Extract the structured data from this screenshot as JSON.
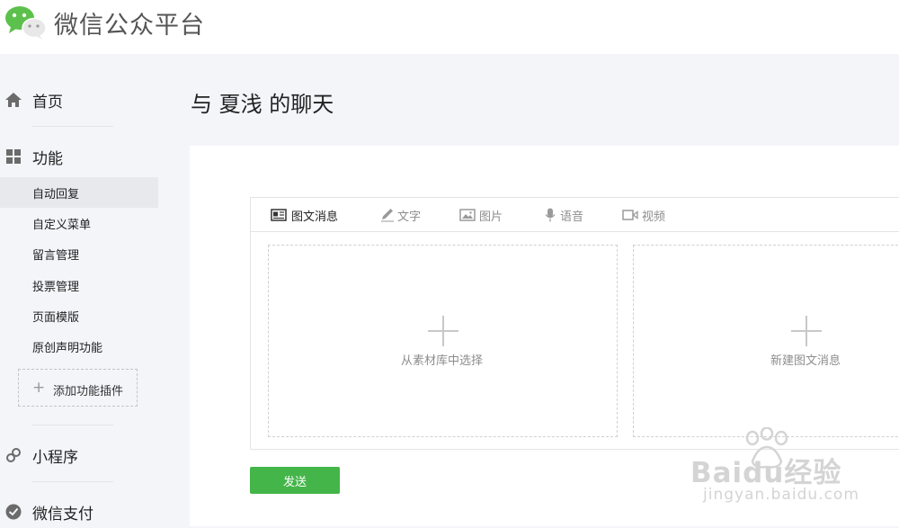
{
  "app": {
    "name": "微信公众平台"
  },
  "sidebar": {
    "home": "首页",
    "features": "功能",
    "feature_items": [
      "自动回复",
      "自定义菜单",
      "留言管理",
      "投票管理",
      "页面模版",
      "原创声明功能"
    ],
    "add_plugin": "添加功能插件",
    "mini_program": "小程序",
    "wechat_pay": "微信支付"
  },
  "page": {
    "title": "与 夏浅 的聊天"
  },
  "editor": {
    "tabs": [
      {
        "label": "图文消息",
        "icon": "news-icon",
        "active": true
      },
      {
        "label": "文字",
        "icon": "pencil-icon",
        "active": false
      },
      {
        "label": "图片",
        "icon": "image-icon",
        "active": false
      },
      {
        "label": "语音",
        "icon": "microphone-icon",
        "active": false
      },
      {
        "label": "视频",
        "icon": "video-icon",
        "active": false
      }
    ],
    "select_from_library": "从素材库中选择",
    "create_news": "新建图文消息"
  },
  "actions": {
    "send": "发送"
  },
  "watermark": {
    "brand": "Baidu经验",
    "url": "jingyan.baidu.com"
  },
  "colors": {
    "accent_green": "#44b549",
    "sidebar_bg": "#f4f5f9",
    "active_item_bg": "#e8e9ed"
  }
}
